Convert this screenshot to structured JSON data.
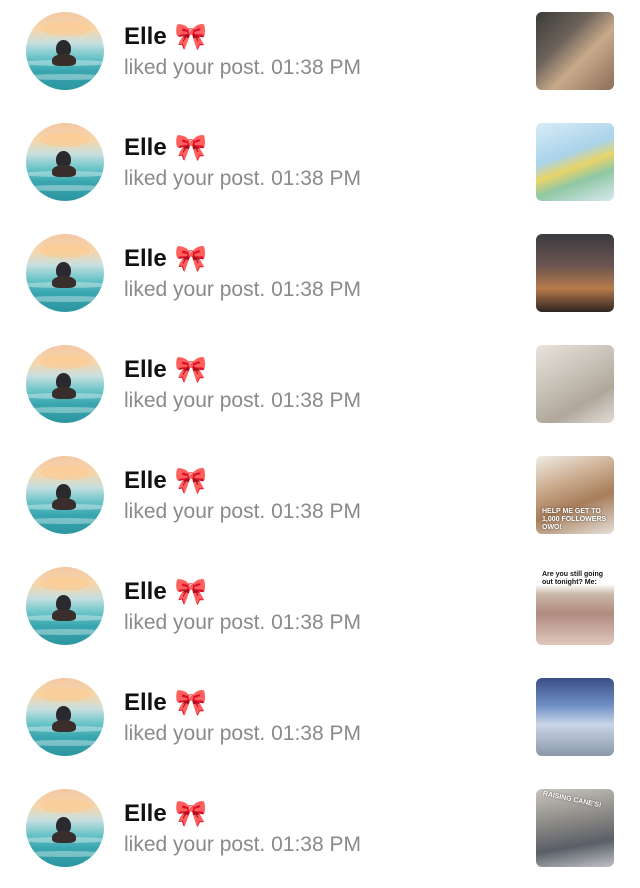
{
  "notifications": [
    {
      "user": "Elle",
      "emoji": "🎀",
      "action": "liked your post.",
      "time": "01:38 PM",
      "thumb_caption": "",
      "thumb_icon": "cats-photo"
    },
    {
      "user": "Elle",
      "emoji": "🎀",
      "action": "liked your post.",
      "time": "01:38 PM",
      "thumb_caption": "",
      "thumb_icon": "world-map-photo"
    },
    {
      "user": "Elle",
      "emoji": "🎀",
      "action": "liked your post.",
      "time": "01:38 PM",
      "thumb_caption": "",
      "thumb_icon": "sunset-thank-you-photo"
    },
    {
      "user": "Elle",
      "emoji": "🎀",
      "action": "liked your post.",
      "time": "01:38 PM",
      "thumb_caption": "",
      "thumb_icon": "makeup-products-photo"
    },
    {
      "user": "Elle",
      "emoji": "🎀",
      "action": "liked your post.",
      "time": "01:38 PM",
      "thumb_caption": "HELP ME GET TO 1,000 FOLLOWERS OWO!",
      "thumb_icon": "cat-meme-photo"
    },
    {
      "user": "Elle",
      "emoji": "🎀",
      "action": "liked your post.",
      "time": "01:38 PM",
      "thumb_caption": "Are you still going out tonight? Me:",
      "thumb_icon": "baby-meme-photo"
    },
    {
      "user": "Elle",
      "emoji": "🎀",
      "action": "liked your post.",
      "time": "01:38 PM",
      "thumb_caption": "",
      "thumb_icon": "airplane-photo"
    },
    {
      "user": "Elle",
      "emoji": "🎀",
      "action": "liked your post.",
      "time": "01:38 PM",
      "thumb_caption": "RAISING CANE'S!",
      "thumb_icon": "street-photo"
    }
  ]
}
